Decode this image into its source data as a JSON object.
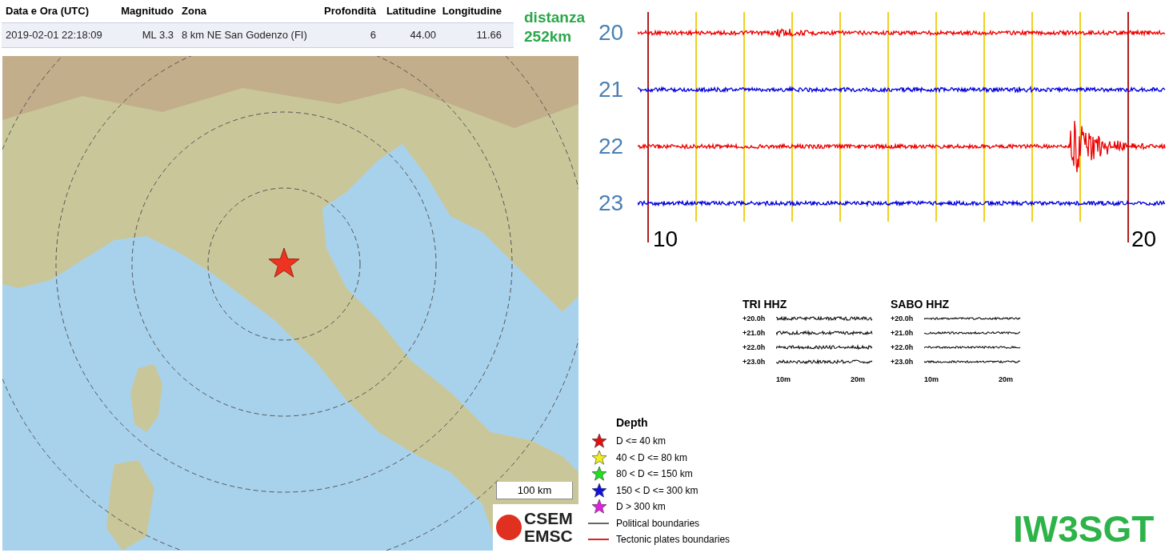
{
  "table": {
    "columns": [
      "Data e Ora (UTC)",
      "Magnitudo",
      "Zona",
      "Profondità",
      "Latitudine",
      "Longitudine"
    ],
    "rows": [
      {
        "cells": [
          "2019-02-01 22:18:09",
          "ML 3.3",
          "8 km NE San Godenzo (FI)",
          "6",
          "44.00",
          "11.66"
        ]
      }
    ]
  },
  "distance": {
    "label": "distanza",
    "value": "252km"
  },
  "map": {
    "scale_label": "100 km",
    "logo_lines": [
      "CSEM",
      "EMSC"
    ]
  },
  "legend": {
    "title": "Depth",
    "depth_items": [
      {
        "label": "D <= 40 km",
        "color": "#e01010"
      },
      {
        "label": "40 < D <= 80 km",
        "color": "#f0f020"
      },
      {
        "label": "80 < D <= 150 km",
        "color": "#20e020"
      },
      {
        "label": "150 < D <= 300 km",
        "color": "#1010e0"
      },
      {
        "label": "D > 300 km",
        "color": "#e020e0"
      }
    ],
    "line_items": [
      {
        "label": "Political boundaries",
        "color": "#666666"
      },
      {
        "label": "Tectonic plates boundaries",
        "color": "#e02020"
      }
    ]
  },
  "seismogram": {
    "traces": [
      {
        "label": "20",
        "color": "#ee0000"
      },
      {
        "label": "21",
        "color": "#0000dd"
      },
      {
        "label": "22",
        "color": "#ee0000"
      },
      {
        "label": "23",
        "color": "#0000dd"
      }
    ],
    "minute_labels": [
      "10",
      "20"
    ]
  },
  "thumbnails": [
    {
      "title": "TRI HHZ",
      "hour_labels": [
        "+20.0h",
        "+21.0h",
        "+22.0h",
        "+23.0h"
      ],
      "minute_labels": [
        "10m",
        "20m"
      ]
    },
    {
      "title": "SABO HHZ",
      "hour_labels": [
        "+20.0h",
        "+21.0h",
        "+22.0h",
        "+23.0h"
      ],
      "minute_labels": [
        "10m",
        "20m"
      ]
    }
  ],
  "callsign": "IW3SGT"
}
